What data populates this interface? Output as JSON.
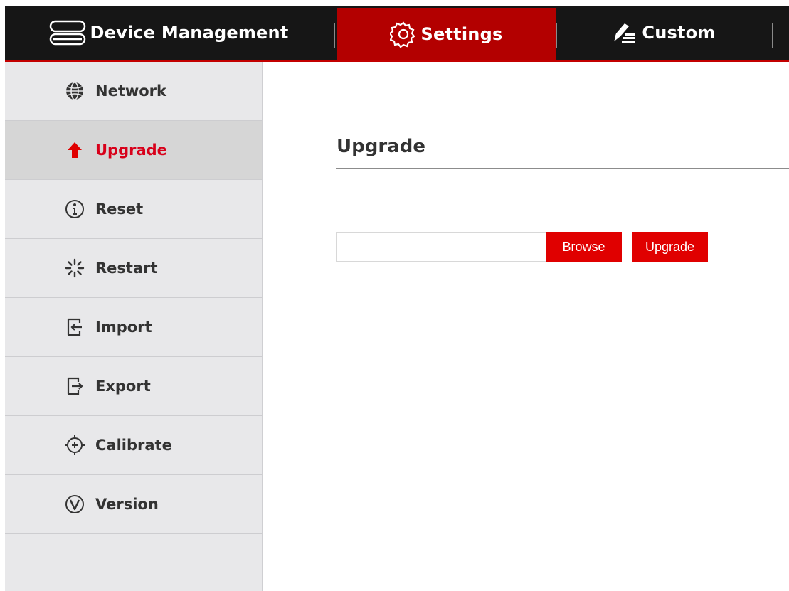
{
  "header": {
    "tabs": [
      {
        "label": "Device Management",
        "icon": "device-management-icon"
      },
      {
        "label": "Settings",
        "icon": "gear-icon",
        "active": true
      },
      {
        "label": "Custom",
        "icon": "pen-list-icon"
      }
    ]
  },
  "sidebar": {
    "items": [
      {
        "label": "Network",
        "icon": "globe-icon"
      },
      {
        "label": "Upgrade",
        "icon": "arrow-up-icon",
        "active": true
      },
      {
        "label": "Reset",
        "icon": "info-circle-icon"
      },
      {
        "label": "Restart",
        "icon": "spinner-icon"
      },
      {
        "label": "Import",
        "icon": "import-icon"
      },
      {
        "label": "Export",
        "icon": "export-icon"
      },
      {
        "label": "Calibrate",
        "icon": "crosshair-icon"
      },
      {
        "label": "Version",
        "icon": "version-icon"
      }
    ]
  },
  "main": {
    "title": "Upgrade",
    "file_input": {
      "value": "",
      "placeholder": ""
    },
    "browse_label": "Browse",
    "upgrade_label": "Upgrade"
  },
  "colors": {
    "accent": "#e00000",
    "header_bg": "#161616",
    "active_tab_bg": "#b30000",
    "sidebar_bg": "#e8e8ea",
    "active_text": "#d8001a"
  }
}
